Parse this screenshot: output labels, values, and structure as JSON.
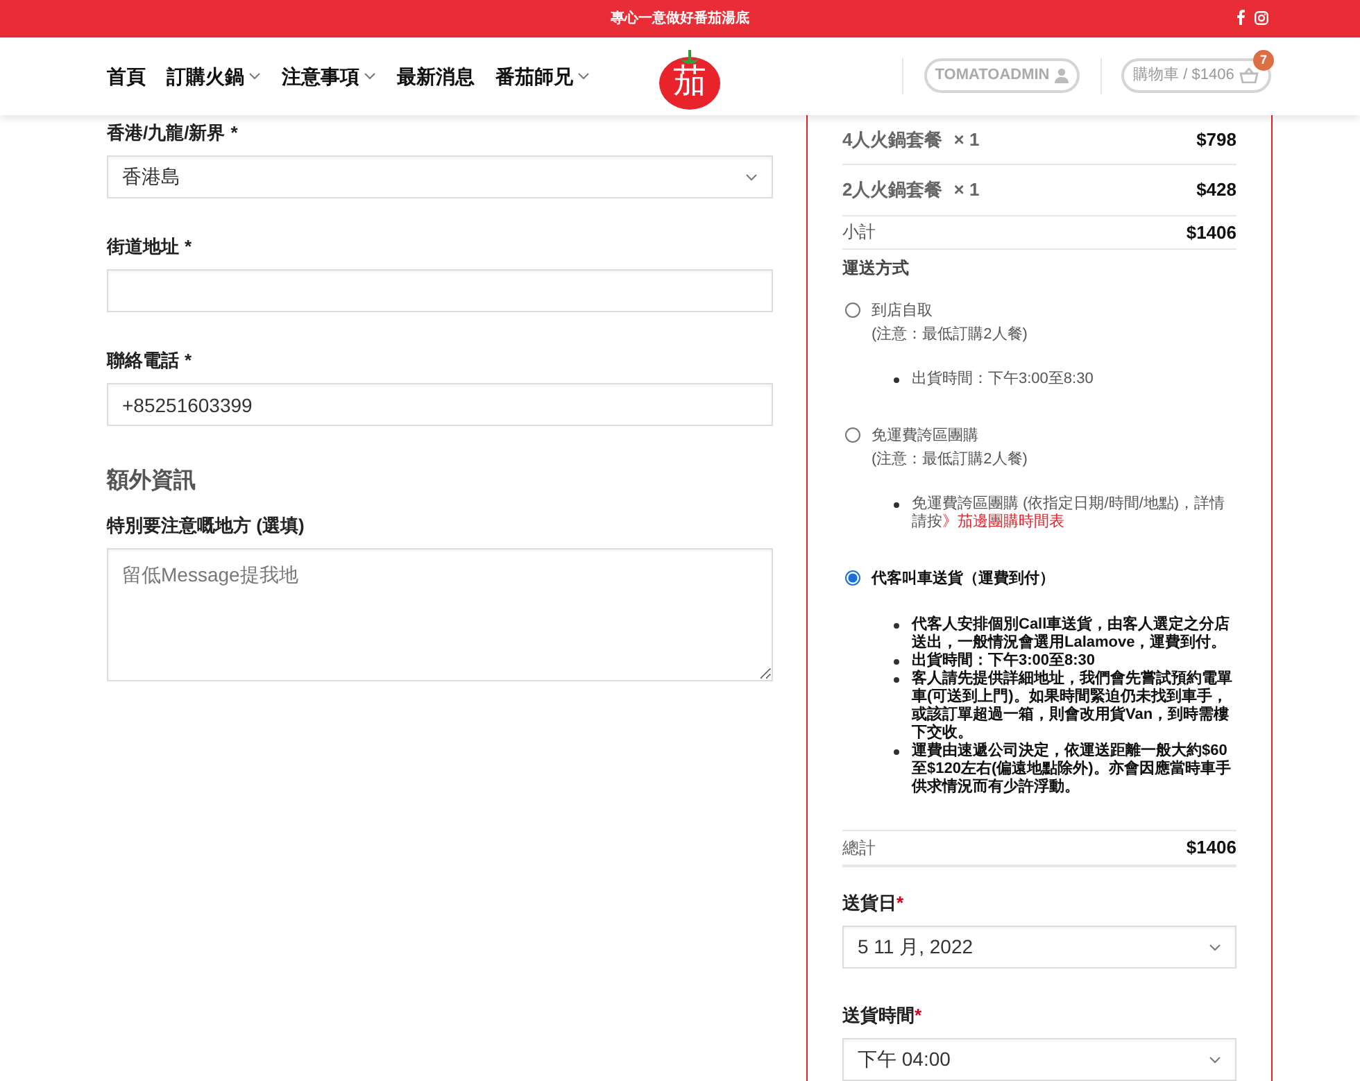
{
  "top_bar": {
    "announcement": "專心一意做好番茄湯底"
  },
  "nav": {
    "items": [
      {
        "label": "首頁",
        "dropdown": false
      },
      {
        "label": "訂購火鍋",
        "dropdown": true
      },
      {
        "label": "注意事項",
        "dropdown": true
      },
      {
        "label": "最新消息",
        "dropdown": false
      },
      {
        "label": "番茄師兄",
        "dropdown": true
      }
    ],
    "logo": {
      "text": "茄"
    },
    "account": {
      "label": "TOMATOADMIN"
    },
    "cart": {
      "label": "購物車 / $1406",
      "count": "7"
    }
  },
  "billing_fields": [
    {
      "label": "香港/九龍/新界",
      "required_mark": "*",
      "kind": "select",
      "value": "香港島"
    },
    {
      "label": "街道地址",
      "required_mark": "*",
      "kind": "input"
    },
    {
      "label": "聯絡電話",
      "required_mark": "*",
      "kind": "input",
      "value": "+85251603399"
    }
  ],
  "extra_info": {
    "heading": "額外資訊",
    "label": "特別要注意嘅地方 (選填)",
    "placeholder": "留低Message提我地"
  },
  "order": {
    "items": [
      {
        "name": "4人火鍋套餐",
        "qty": "× 1",
        "price": "$798"
      },
      {
        "name": "2人火鍋套餐",
        "qty": "× 1",
        "price": "$428"
      }
    ],
    "subtotal": {
      "label": "小計",
      "value": "$1406"
    },
    "shipping": {
      "label": "運送方式",
      "options": [
        {
          "selected": false,
          "title": "到店自取",
          "note": "(注意：最低訂購2人餐)",
          "bullets": [
            {
              "text": "出貨時間：下午3:00至8:30"
            }
          ]
        },
        {
          "selected": false,
          "title": "免運費誇區團購",
          "note": "(注意：最低訂購2人餐)",
          "bullets": [
            {
              "text": "免運費誇區團購 (依指定日期/時間/地點)，詳情請按",
              "link": "》茄邊團購時間表"
            }
          ]
        },
        {
          "selected": true,
          "title": "代客叫車送貨（運費到付）",
          "bullets": [
            {
              "text": "代客人安排個別Call車送貨，由客人選定之分店送出，一般情況會選用Lalamove，運費到付。"
            },
            {
              "text": "出貨時間：下午3:00至8:30"
            },
            {
              "text": "客人請先提供詳細地址，我們會先嘗試預約電單車(可送到上門)。如果時間緊迫仍未找到車手，或該訂單超過一箱，則會改用貨Van，到時需樓下交收。"
            },
            {
              "text": "運費由速遞公司決定，依運送距離一般大約$60至$120左右(偏遠地點除外)。亦會因應當時車手供求情況而有少許浮動。"
            }
          ]
        }
      ]
    },
    "total": {
      "label": "總計",
      "value": "$1406"
    },
    "delivery_fields": [
      {
        "label": "送貨日",
        "required_mark": "*",
        "value": "5 11 月, 2022"
      },
      {
        "label": "送貨時間",
        "required_mark": "*",
        "value": "下午 04:00"
      }
    ]
  }
}
